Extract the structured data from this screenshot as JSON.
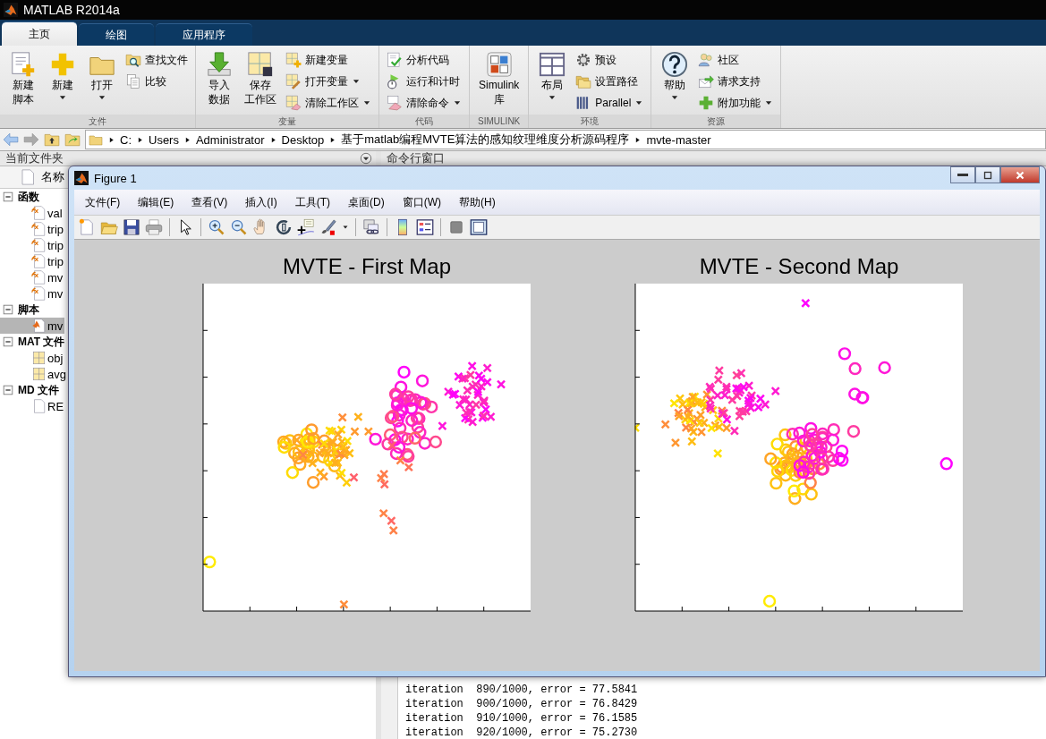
{
  "window": {
    "title": "MATLAB R2014a"
  },
  "ribbon_tabs": [
    {
      "label": "主页",
      "selected": true
    },
    {
      "label": "绘图",
      "selected": false
    },
    {
      "label": "应用程序",
      "selected": false
    }
  ],
  "ribbon_groups": [
    {
      "label": "文件",
      "items": [
        {
          "kind": "large",
          "lines": [
            "新建",
            "脚本"
          ],
          "dropdown": false
        },
        {
          "kind": "large",
          "lines": [
            "新建"
          ],
          "dropdown": true
        },
        {
          "kind": "large",
          "lines": [
            "打开"
          ],
          "dropdown": true
        },
        {
          "kind": "small",
          "lines": [
            "查找文件"
          ],
          "dropdown": false
        },
        {
          "kind": "small",
          "lines": [
            "比较"
          ],
          "dropdown": false
        }
      ]
    },
    {
      "label": "变量",
      "items": [
        {
          "kind": "large",
          "lines": [
            "导入",
            "数据"
          ],
          "dropdown": false
        },
        {
          "kind": "large",
          "lines": [
            "保存",
            "工作区"
          ],
          "dropdown": false
        },
        {
          "kind": "small",
          "lines": [
            "新建变量"
          ],
          "dropdown": false
        },
        {
          "kind": "small",
          "lines": [
            "打开变量"
          ],
          "dropdown": true
        },
        {
          "kind": "small",
          "lines": [
            "清除工作区"
          ],
          "dropdown": true
        }
      ]
    },
    {
      "label": "代码",
      "items": [
        {
          "kind": "small",
          "lines": [
            "分析代码"
          ],
          "dropdown": false
        },
        {
          "kind": "small",
          "lines": [
            "运行和计时"
          ],
          "dropdown": false
        },
        {
          "kind": "small",
          "lines": [
            "清除命令"
          ],
          "dropdown": true
        }
      ]
    },
    {
      "label": "SIMULINK",
      "items": [
        {
          "kind": "large",
          "lines": [
            "Simulink",
            "库"
          ],
          "dropdown": false
        }
      ]
    },
    {
      "label": "环境",
      "items": [
        {
          "kind": "large",
          "lines": [
            "布局"
          ],
          "dropdown": true
        },
        {
          "kind": "small",
          "lines": [
            "预设"
          ],
          "dropdown": false
        },
        {
          "kind": "small",
          "lines": [
            "设置路径"
          ],
          "dropdown": false
        },
        {
          "kind": "small",
          "lines": [
            "Parallel"
          ],
          "dropdown": true
        }
      ]
    },
    {
      "label": "资源",
      "items": [
        {
          "kind": "large",
          "lines": [
            "帮助"
          ],
          "dropdown": true
        },
        {
          "kind": "small",
          "lines": [
            "社区"
          ],
          "dropdown": false
        },
        {
          "kind": "small",
          "lines": [
            "请求支持"
          ],
          "dropdown": false
        },
        {
          "kind": "small",
          "lines": [
            "附加功能"
          ],
          "dropdown": true
        }
      ]
    }
  ],
  "address_bar": {
    "segments": [
      "C:",
      "Users",
      "Administrator",
      "Desktop",
      "基于matlab编程MVTE算法的感知纹理维度分析源码程序",
      "mvte-master"
    ]
  },
  "current_folder": {
    "title": "当前文件夹",
    "column": "名称",
    "tree": [
      {
        "label": "函数",
        "expanded": true,
        "children": [
          {
            "label": "val",
            "kind": "function",
            "selected": false
          },
          {
            "label": "trip",
            "kind": "function",
            "selected": false
          },
          {
            "label": "trip",
            "kind": "function",
            "selected": false
          },
          {
            "label": "trip",
            "kind": "function",
            "selected": false
          },
          {
            "label": "mv",
            "kind": "function",
            "selected": false
          },
          {
            "label": "mv",
            "kind": "function",
            "selected": false
          }
        ]
      },
      {
        "label": "脚本",
        "expanded": true,
        "children": [
          {
            "label": "mv",
            "kind": "script",
            "selected": true
          }
        ]
      },
      {
        "label": "MAT 文件",
        "expanded": true,
        "children": [
          {
            "label": "obj",
            "kind": "mat",
            "selected": false
          },
          {
            "label": "avg",
            "kind": "mat",
            "selected": false
          }
        ]
      },
      {
        "label": "MD 文件",
        "expanded": true,
        "children": [
          {
            "label": "RE",
            "kind": "md",
            "selected": false
          }
        ]
      }
    ]
  },
  "command_window": {
    "title": "命令行窗口",
    "lines": [
      "iteration  890/1000, error = 77.5841",
      "iteration  900/1000, error = 76.8429",
      "iteration  910/1000, error = 76.1585",
      "iteration  920/1000, error = 75.2730"
    ]
  },
  "figure": {
    "title": "Figure 1",
    "menu": [
      "文件(F)",
      "编辑(E)",
      "查看(V)",
      "插入(I)",
      "工具(T)",
      "桌面(D)",
      "窗口(W)",
      "帮助(H)"
    ],
    "axes": [
      {
        "title": "MVTE - First Map"
      },
      {
        "title": "MVTE - Second Map"
      }
    ]
  }
}
